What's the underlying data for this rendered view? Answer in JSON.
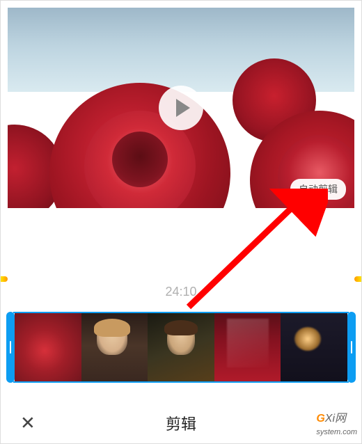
{
  "preview": {
    "auto_clip_label": "自动剪辑"
  },
  "timeline": {
    "time_label": "24:10"
  },
  "bottom": {
    "title": "剪辑",
    "cancel_icon": "close-icon"
  },
  "watermark": {
    "prefix": "G",
    "mid": "Xi",
    "suffix": "网",
    "domain": "system.com"
  }
}
